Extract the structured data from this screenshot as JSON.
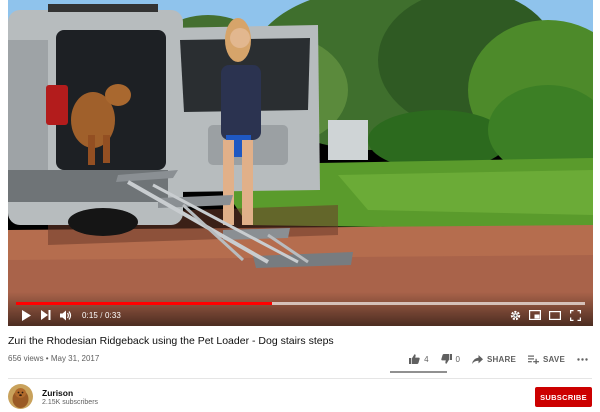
{
  "player": {
    "time_current": "0:15",
    "time_separator": " / ",
    "time_total": "0:33",
    "progress_played": 0.45,
    "progress_buffered": 1.0,
    "icons": [
      "play-icon",
      "next-icon",
      "volume-icon",
      "settings-icon",
      "miniplayer-icon",
      "theater-icon",
      "fullscreen-icon"
    ]
  },
  "video": {
    "title": "Zuri the Rhodesian Ridgeback using the Pet Loader - Dog stairs steps",
    "views": "656 views",
    "dot": " • ",
    "date": "May 31, 2017"
  },
  "actions": {
    "like_count": "4",
    "dislike_count": "0",
    "share_label": "SHARE",
    "save_label": "SAVE",
    "like_ratio": 1.0
  },
  "channel": {
    "name": "Zurison",
    "subscribers": "2.15K subscribers",
    "subscribe_label": "SUBSCRIBE"
  },
  "colors": {
    "progress": "#ff0000",
    "subscribe": "#cc0000",
    "muted_text": "#606060"
  }
}
